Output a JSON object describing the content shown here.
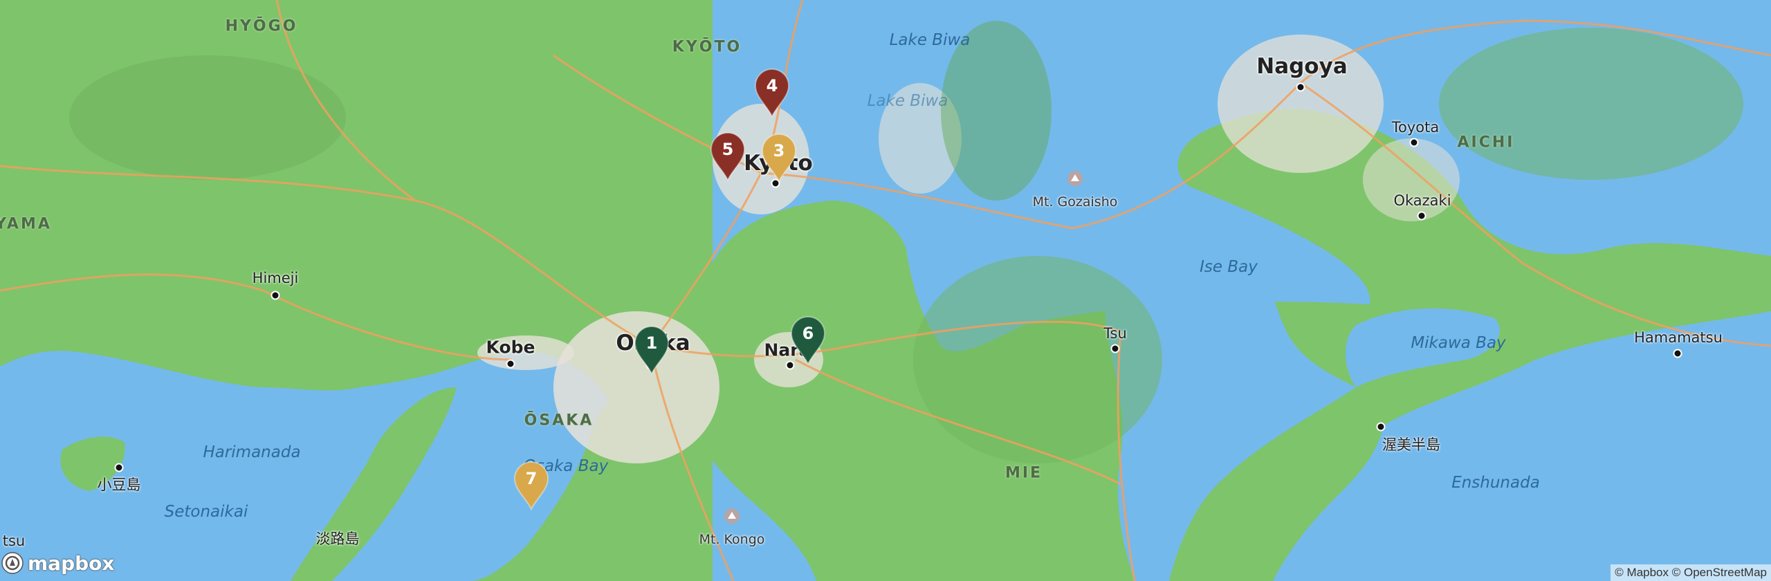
{
  "map": {
    "colors": {
      "water": "#74b9ec",
      "land": "#7ec46b",
      "urban": "#e6e2d8",
      "road": "#f0a060"
    },
    "labels": [
      {
        "key": "hyogo",
        "text": "HYŌGO",
        "kind": "region"
      },
      {
        "key": "kyoto-pref",
        "text": "KYŌTO",
        "kind": "region"
      },
      {
        "key": "osaka-pref",
        "text": "ŌSAKA",
        "kind": "region"
      },
      {
        "key": "aichi",
        "text": "AICHI",
        "kind": "region"
      },
      {
        "key": "mie",
        "text": "MIE",
        "kind": "region"
      },
      {
        "key": "okayama-part",
        "text": "YAMA",
        "kind": "region"
      },
      {
        "key": "nagoya",
        "text": "Nagoya",
        "kind": "city-major"
      },
      {
        "key": "kyoto",
        "text": "Kyoto",
        "kind": "city-major"
      },
      {
        "key": "osaka",
        "text": "Osaka",
        "kind": "city-major"
      },
      {
        "key": "kobe",
        "text": "Kobe",
        "kind": "city"
      },
      {
        "key": "nara",
        "text": "Nara",
        "kind": "city"
      },
      {
        "key": "himeji",
        "text": "Himeji",
        "kind": "town"
      },
      {
        "key": "toyota",
        "text": "Toyota",
        "kind": "town"
      },
      {
        "key": "okazaki",
        "text": "Okazaki",
        "kind": "town"
      },
      {
        "key": "tsu",
        "text": "Tsu",
        "kind": "town"
      },
      {
        "key": "hamamatsu",
        "text": "Hamamatsu",
        "kind": "town"
      },
      {
        "key": "shodoshima",
        "text": "小豆島",
        "kind": "town"
      },
      {
        "key": "awajishima",
        "text": "淡路島",
        "kind": "town"
      },
      {
        "key": "atsumi",
        "text": "渥美半島",
        "kind": "town"
      },
      {
        "key": "tokushima-part",
        "text": "tsu",
        "kind": "town"
      },
      {
        "key": "lake-biwa",
        "text": "Lake Biwa",
        "kind": "water"
      },
      {
        "key": "lake-biwa-2",
        "text": "Lake Biwa",
        "kind": "water"
      },
      {
        "key": "ise-bay",
        "text": "Ise Bay",
        "kind": "water"
      },
      {
        "key": "mikawa-bay",
        "text": "Mikawa Bay",
        "kind": "water"
      },
      {
        "key": "osaka-bay",
        "text": "Osaka Bay",
        "kind": "water"
      },
      {
        "key": "harimanada",
        "text": "Harimanada",
        "kind": "water"
      },
      {
        "key": "setonaikai",
        "text": "Setonaikai",
        "kind": "water"
      },
      {
        "key": "enshunada",
        "text": "Enshunada",
        "kind": "water"
      },
      {
        "key": "mt-gozaisho",
        "text": "Mt. Gozaisho",
        "kind": "peak"
      },
      {
        "key": "mt-kongo",
        "text": "Mt. Kongo",
        "kind": "peak"
      }
    ],
    "markers": [
      {
        "number": "1",
        "color": "#1f5a3e"
      },
      {
        "number": "3",
        "color": "#d9a84a"
      },
      {
        "number": "4",
        "color": "#8a2f26"
      },
      {
        "number": "5",
        "color": "#8a2f26"
      },
      {
        "number": "6",
        "color": "#1f5a3e"
      },
      {
        "number": "7",
        "color": "#d9a84a"
      }
    ]
  },
  "logo": {
    "text": "mapbox",
    "icon": "mapbox-logo-icon"
  },
  "attribution": "© Mapbox © OpenStreetMap"
}
